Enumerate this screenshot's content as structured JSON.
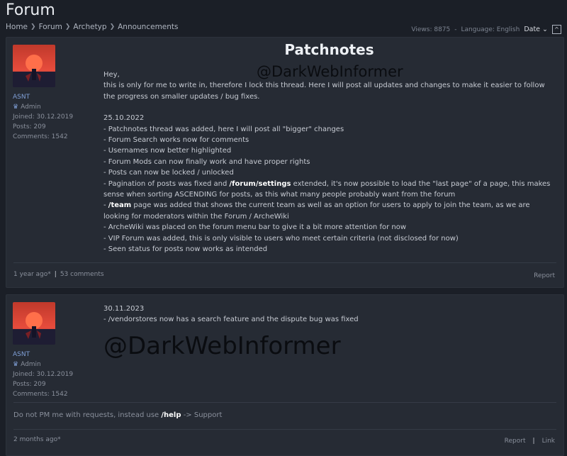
{
  "page": {
    "title": "Forum",
    "breadcrumb": [
      "Home",
      "Forum",
      "Archetyp",
      "Announcements"
    ],
    "views": "Views: 8875",
    "language": "Language: English",
    "sort": "Date"
  },
  "watermarks": [
    "@DarkWebInformer",
    "@DarkWebInformer"
  ],
  "posts": [
    {
      "title": "Patchnotes",
      "author": {
        "name": "ASNT",
        "role": "Admin",
        "joined": "Joined: 30.12.2019",
        "posts": "Posts: 209",
        "comments": "Comments: 1542"
      },
      "intro": [
        "Hey,",
        "this is only for me to write in, therefore I lock this thread. Here I will post all updates and changes to make it easier to follow the progress on smaller updates / bug fixes."
      ],
      "date": "25.10.2022",
      "lines": [
        "- Patchnotes thread was added, here I will post all \"bigger\" changes",
        "- Forum Search works now for comments",
        "- Usernames now better highlighted",
        "- Forum Mods can now finally work and have proper rights",
        "- Posts can now be locked / unlocked"
      ],
      "pagination_pre": "- Pagination of posts was fixed and ",
      "pagination_link": "/forum/settings",
      "pagination_post": " extended, it's now possible to load the \"last page\" of a page, this makes sense when sorting ASCENDING for posts, as this what many people probably want from the forum",
      "team_pre": "- ",
      "team_link": "/team",
      "team_post": " page was added that shows the current team as well as an option for users to apply to join the team, as we are looking for moderators within the Forum / ArcheWiki",
      "lines2": [
        "- ArcheWiki was placed on the forum menu bar to give it a bit more attention for now",
        "- VIP Forum was added, this is only visible to users who meet certain criteria (not disclosed for now)",
        "- Seen status for posts now works as intended"
      ],
      "time": "1 year ago*",
      "comments_link": "53 comments",
      "report": "Report"
    },
    {
      "author": {
        "name": "ASNT",
        "role": "Admin",
        "joined": "Joined: 30.12.2019",
        "posts": "Posts: 209",
        "comments": "Comments: 1542"
      },
      "date": "30.11.2023",
      "line": "- /vendorstores now has a search feature and the dispute bug was fixed",
      "signature_pre": "Do not PM me with requests, instead use ",
      "signature_link": "/help",
      "signature_post": " -> Support",
      "time": "2 months ago*",
      "report": "Report",
      "link": "Link"
    }
  ]
}
